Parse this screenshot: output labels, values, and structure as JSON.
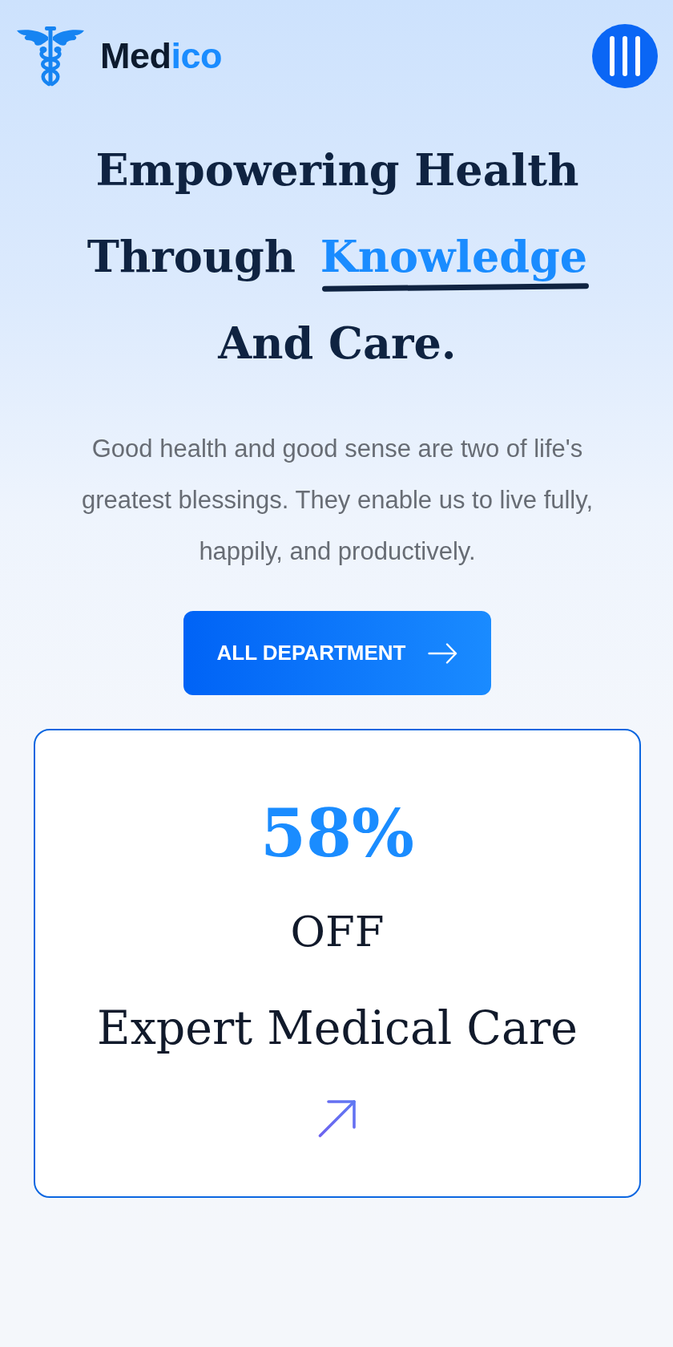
{
  "header": {
    "logo_text": [
      {
        "text": "Med",
        "accent": false
      },
      {
        "text": "ico",
        "accent": true
      }
    ]
  },
  "hero": {
    "headline": {
      "before": "Empowering Health Through",
      "highlight": "Knowledge",
      "after": "And Care."
    },
    "description": "Good health and good sense are two of life's greatest blessings. They enable us to live fully, happily, and productively.",
    "button": {
      "label": "ALL DEPARTMENT"
    }
  },
  "offer_card": {
    "discount": "58%",
    "off_label": "OFF",
    "title": "Expert Medical Care"
  }
}
